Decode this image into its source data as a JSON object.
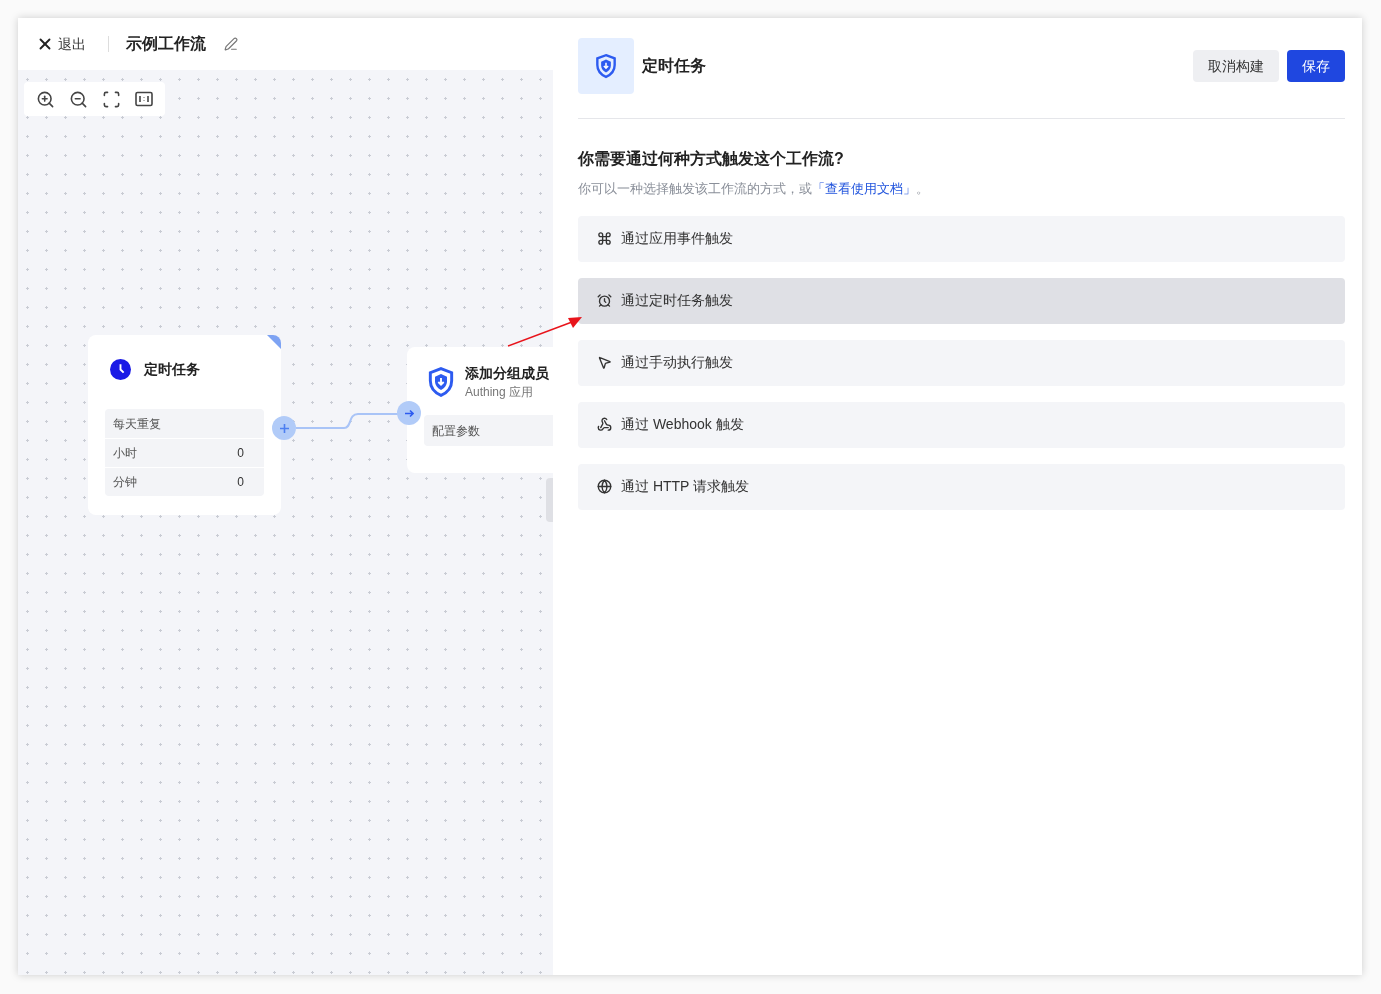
{
  "header": {
    "exit_label": "退出",
    "title": "示例工作流"
  },
  "canvas": {
    "trigger_node": {
      "title": "定时任务",
      "rows": [
        {
          "label": "每天重复"
        },
        {
          "label": "小时",
          "value": "0"
        },
        {
          "label": "分钟",
          "value": "0"
        }
      ]
    },
    "action_node": {
      "title": "添加分组成员",
      "subtitle": "Authing 应用",
      "rows": [
        {
          "label": "配置参数"
        }
      ]
    }
  },
  "panel": {
    "title": "定时任务",
    "buttons": [
      {
        "label": "取消构建",
        "kind": "secondary"
      },
      {
        "label": "保存",
        "kind": "primary"
      }
    ],
    "question": "你需要通过何种方式触发这个工作流?",
    "hint": "你可以一种选择触发该工作流的方式，或",
    "hint_link": "「查看使用文档」",
    "hint_tail": "。",
    "options": [
      {
        "label": "通过应用事件触发",
        "kind": "app_event",
        "selected": false
      },
      {
        "label": "通过定时任务触发",
        "kind": "schedule",
        "selected": true
      },
      {
        "label": "通过手动执行触发",
        "kind": "manual",
        "selected": false
      },
      {
        "label": "通过 Webhook 触发",
        "kind": "webhook",
        "selected": false
      },
      {
        "label": "通过 HTTP 请求触发",
        "kind": "http",
        "selected": false
      }
    ]
  }
}
